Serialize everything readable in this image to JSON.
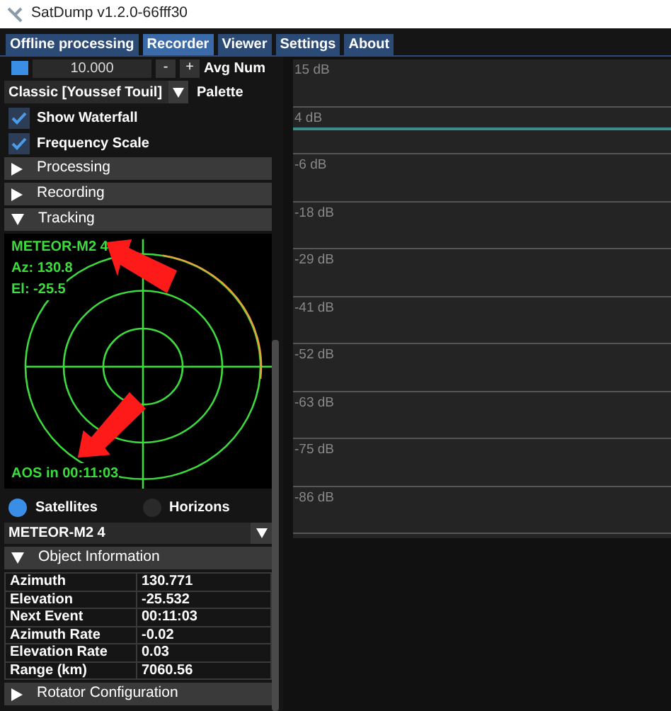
{
  "window": {
    "title": "SatDump v1.2.0-66fff30"
  },
  "tabs": [
    {
      "label": "Offline processing",
      "selected": false
    },
    {
      "label": "Recorder",
      "selected": true
    },
    {
      "label": "Viewer",
      "selected": false
    },
    {
      "label": "Settings",
      "selected": false
    },
    {
      "label": "About",
      "selected": false
    }
  ],
  "avg": {
    "checked": true,
    "value": "10.000",
    "minus": "-",
    "plus": "+",
    "label": "Avg Num"
  },
  "palette": {
    "value": "Classic [Youssef Touil]",
    "label": "Palette"
  },
  "checks": [
    {
      "label": "Show Waterfall",
      "checked": true
    },
    {
      "label": "Frequency Scale",
      "checked": true
    }
  ],
  "sections": [
    {
      "label": "Processing",
      "expanded": false
    },
    {
      "label": "Recording",
      "expanded": false
    },
    {
      "label": "Tracking",
      "expanded": true
    }
  ],
  "radar": {
    "name": "METEOR-M2 4",
    "az": "Az: 130.8",
    "el": "El: -25.5",
    "aos": "AOS in 00:11:03"
  },
  "modes": [
    {
      "label": "Satellites",
      "selected": true
    },
    {
      "label": "Horizons",
      "selected": false
    }
  ],
  "satellite": {
    "value": "METEOR-M2 4"
  },
  "object_info": {
    "label": "Object Information",
    "expanded": true,
    "rows": [
      {
        "name": "Azimuth",
        "value": "130.771"
      },
      {
        "name": "Elevation",
        "value": "-25.532"
      },
      {
        "name": "Next Event",
        "value": "00:11:03"
      },
      {
        "name": "Azimuth Rate",
        "value": "-0.02"
      },
      {
        "name": "Elevation Rate",
        "value": "0.03"
      },
      {
        "name": "Range (km)",
        "value": "7060.56"
      }
    ]
  },
  "rotator": {
    "label": "Rotator Configuration",
    "expanded": false
  },
  "spectrum": {
    "db_labels": [
      "15 dB",
      "4 dB",
      "-6 dB",
      "-18 dB",
      "-29 dB",
      "-41 dB",
      "-52 dB",
      "-63 dB",
      "-75 dB",
      "-86 dB"
    ]
  }
}
